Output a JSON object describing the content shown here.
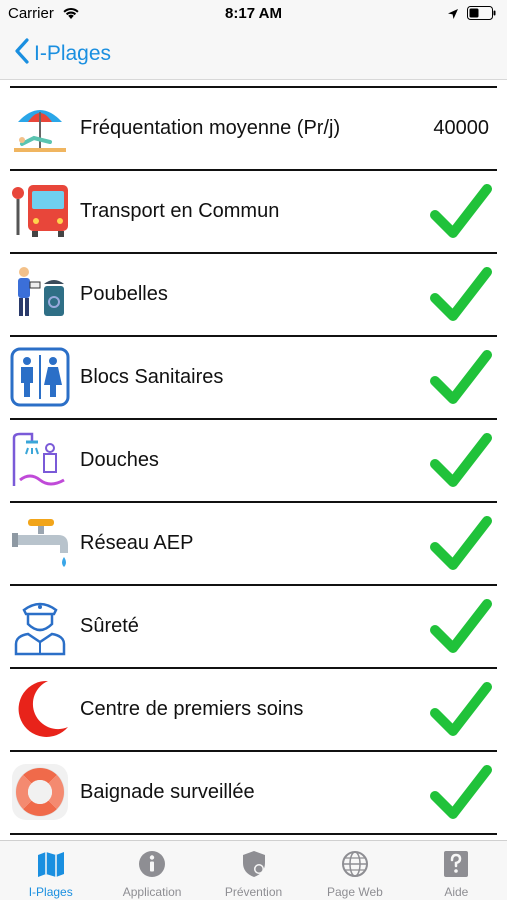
{
  "status_bar": {
    "carrier": "Carrier",
    "time": "8:17 AM"
  },
  "nav": {
    "back_label": "I-Plages"
  },
  "rows": [
    {
      "label": "Fréquentation moyenne (Pr/j)",
      "value": "40000",
      "icon": "beach-umbrella-icon"
    },
    {
      "label": "Transport en Commun",
      "checked": true,
      "icon": "bus-icon"
    },
    {
      "label": "Poubelles",
      "checked": true,
      "icon": "trash-bin-icon"
    },
    {
      "label": "Blocs Sanitaires",
      "checked": true,
      "icon": "restroom-icon"
    },
    {
      "label": "Douches",
      "checked": true,
      "icon": "shower-icon"
    },
    {
      "label": "Réseau AEP",
      "checked": true,
      "icon": "water-tap-icon"
    },
    {
      "label": "Sûreté",
      "checked": true,
      "icon": "police-officer-icon"
    },
    {
      "label": "Centre de premiers soins",
      "checked": true,
      "icon": "red-crescent-icon"
    },
    {
      "label": "Baignade surveillée",
      "checked": true,
      "icon": "lifebuoy-icon"
    }
  ],
  "tabs": [
    {
      "label": "I-Plages",
      "icon": "map-icon",
      "active": true
    },
    {
      "label": "Application",
      "icon": "info-icon",
      "active": false
    },
    {
      "label": "Prévention",
      "icon": "shield-icon",
      "active": false
    },
    {
      "label": "Page Web",
      "icon": "globe-icon",
      "active": false
    },
    {
      "label": "Aide",
      "icon": "help-icon",
      "active": false
    }
  ],
  "colors": {
    "accent": "#1a8fe0",
    "check": "#20c23a",
    "inactive": "#8e8e93"
  }
}
